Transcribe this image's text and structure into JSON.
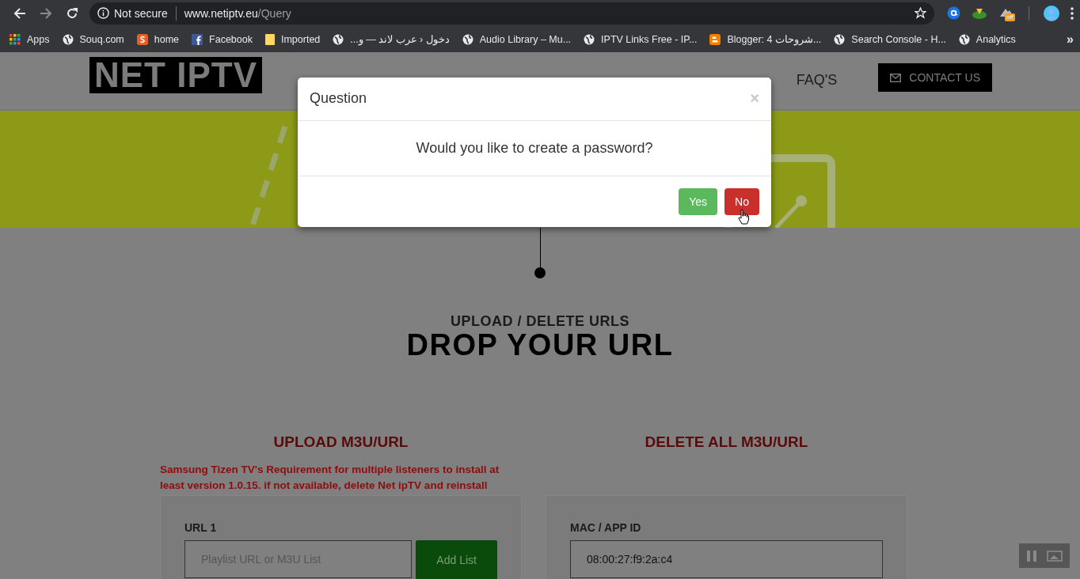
{
  "browser": {
    "security": "Not secure",
    "url_host": "www.netiptv.eu",
    "url_path": "/Query",
    "bookmarks": [
      {
        "label": "Apps",
        "kind": "apps"
      },
      {
        "label": "Souq.com",
        "kind": "globe"
      },
      {
        "label": "home",
        "kind": "s"
      },
      {
        "label": "Facebook",
        "kind": "facebook"
      },
      {
        "label": "Imported",
        "kind": "folder"
      },
      {
        "label": "دخول ‹ عرب لاند — و...",
        "kind": "globe"
      },
      {
        "label": "Audio Library – Mu...",
        "kind": "globe"
      },
      {
        "label": "IPTV Links Free - IP...",
        "kind": "globe"
      },
      {
        "label": "Blogger: شروحات 4...",
        "kind": "blogger"
      },
      {
        "label": "Search Console - H...",
        "kind": "globe"
      },
      {
        "label": "Analytics",
        "kind": "globe"
      }
    ],
    "more": "»",
    "extension_badge": "off"
  },
  "site": {
    "logo": "NET IPTV",
    "nav": [
      {
        "label": "FAQ'S"
      }
    ],
    "contact_button": "CONTACT US",
    "subtitle": "UPLOAD / DELETE URLS",
    "title": "DROP YOUR URL",
    "upload": {
      "heading": "UPLOAD M3U/URL",
      "notice": "Samsung Tizen TV's Requirement for multiple listeners to install at least version 1.0.15. if not available, delete Net ipTV and reinstall",
      "field_label": "URL 1",
      "placeholder": "Playlist URL or M3U List",
      "button": "Add List"
    },
    "delete": {
      "heading": "DELETE ALL M3U/URL",
      "field_label": "MAC / APP ID",
      "value": "08:00:27:f9:2a:c4"
    }
  },
  "modal": {
    "title": "Question",
    "close": "×",
    "message": "Would you like to create a password?",
    "buttons": [
      {
        "label": "Yes",
        "kind": "success"
      },
      {
        "label": "No",
        "kind": "danger"
      }
    ]
  }
}
